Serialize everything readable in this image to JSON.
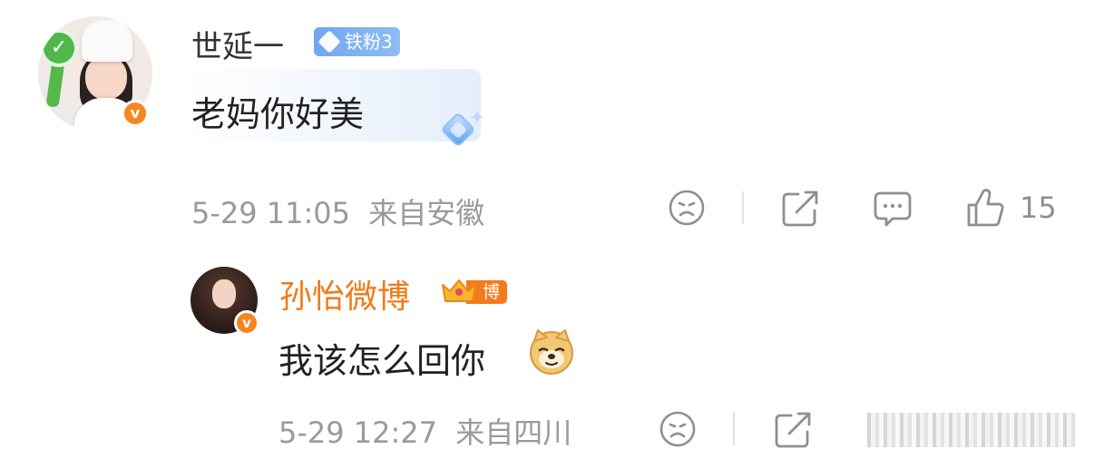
{
  "comment": {
    "username": "世延一",
    "fan_badge": "铁粉3",
    "text": "老妈你好美",
    "time": "5-29 11:05",
    "location": "来自安徽",
    "like_count": "15",
    "icons": [
      "check-icon",
      "verified-icon",
      "gem-icon",
      "dislike-icon",
      "share-icon",
      "comment-icon",
      "like-icon"
    ]
  },
  "reply": {
    "username": "孙怡微博",
    "badge": "博主",
    "text": "我该怎么回你",
    "emoji": "doge-icon",
    "time": "5-29 12:27",
    "location": "来自四川"
  },
  "colors": {
    "orange": "#f27a1a",
    "badge_blue": "#6fa7f0",
    "meta_gray": "#9a9a9a",
    "verified_orange": "#f6861f"
  }
}
